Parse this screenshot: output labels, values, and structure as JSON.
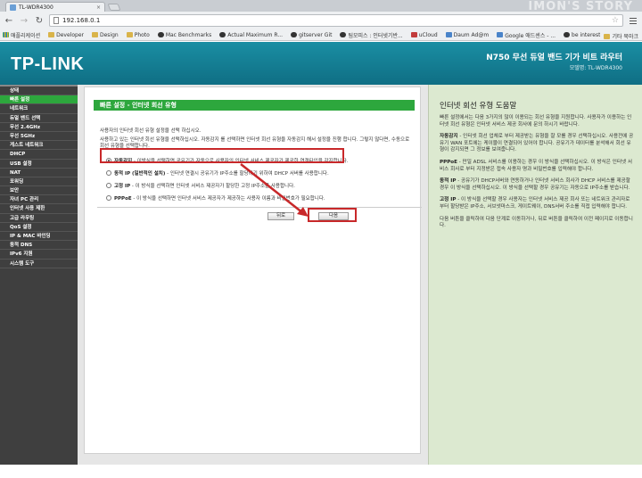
{
  "browser": {
    "tab_title": "TL-WDR4300",
    "tab_close": "×",
    "url": "192.168.0.1",
    "watermark": "IMON'S STORY",
    "bookmarks": [
      {
        "label": "애플리케이션",
        "icon": "apps-grid-icon"
      },
      {
        "label": "Developer",
        "icon": "folder-icon"
      },
      {
        "label": "Design",
        "icon": "folder-icon"
      },
      {
        "label": "Photo",
        "icon": "folder-icon"
      },
      {
        "label": "Mac Benchmarks",
        "icon": "apple-icon"
      },
      {
        "label": "Actual Maximum R...",
        "icon": "site-icon"
      },
      {
        "label": "gitserver Git",
        "icon": "git-icon"
      },
      {
        "label": "팀모피스 : 인터넷기반...",
        "icon": "site-icon"
      },
      {
        "label": "uCloud",
        "icon": "cloud-icon"
      },
      {
        "label": "Daum Ad@m",
        "icon": "daum-icon"
      },
      {
        "label": "Google 애드센스 - ...",
        "icon": "google-icon"
      },
      {
        "label": "be interested in...",
        "icon": "site-icon"
      }
    ],
    "other_bookmarks": "기타 북마크"
  },
  "header": {
    "logo": "TP-LINK",
    "product": "N750 무선 듀얼 밴드 기가 비트 라우터",
    "model": "모델명: TL-WDR4300"
  },
  "nav": {
    "items": [
      {
        "label": "상태",
        "active": false
      },
      {
        "label": "빠른 설정",
        "active": true
      },
      {
        "label": "네트워크",
        "active": false
      },
      {
        "label": "듀얼 밴드 선택",
        "active": false
      },
      {
        "label": "무선 2.4GHz",
        "active": false
      },
      {
        "label": "무선 5GHz",
        "active": false
      },
      {
        "label": "게스트 네트워크",
        "active": false
      },
      {
        "label": "DHCP",
        "active": false
      },
      {
        "label": "USB 설정",
        "active": false
      },
      {
        "label": "NAT",
        "active": false
      },
      {
        "label": "포워딩",
        "active": false
      },
      {
        "label": "보안",
        "active": false
      },
      {
        "label": "자녀 PC 관리",
        "active": false
      },
      {
        "label": "인터넷 사용 제한",
        "active": false
      },
      {
        "label": "고급 라우팅",
        "active": false
      },
      {
        "label": "QoS 설정",
        "active": false
      },
      {
        "label": "IP & MAC 바인딩",
        "active": false
      },
      {
        "label": "동적 DNS",
        "active": false
      },
      {
        "label": "IPv6 지원",
        "active": false
      },
      {
        "label": "시스템 도구",
        "active": false
      }
    ]
  },
  "main": {
    "title": "빠른 설정 - 인터넷 회선 유형",
    "desc1": "사용자의 인터넷 회선 유형 설정을 선택 하십시오.",
    "desc2": "사용하고 있는 인터넷 회선 유형을 선택하십시오. 자동감지 를 선택하면 인터넷 회선 유형을 자동감지 해서 설정을 진행 합니다. 그렇지 않다면, 수동으로 회선 유형을 선택합니다.",
    "options": [
      {
        "name": "자동감지",
        "text": " - 이방식을 선택하면 공유기가 자동으로 사용자의 인터넷 서비스 제공자가 제공한 연결타입을 감지합니다.",
        "selected": true
      },
      {
        "name": "동적 IP (일반적인 설치)",
        "text": " - 인터넷 연결시 공유기가 IP주소를 할당하기 위하여 DHCP 서버를 사용합니다.",
        "selected": false
      },
      {
        "name": "고정 IP",
        "text": " - 이 방식을 선택하면 인터넷 서비스 제공자가 할당한 고정 IP주소를 사용합니다.",
        "selected": false
      },
      {
        "name": "PPPoE",
        "text": " - 이 방식을 선택하면 인터넷 서비스 제공자가 제공하는 사용자 이름과 비밀번호가 필요합니다.",
        "selected": false
      }
    ],
    "back_label": "뒤로",
    "next_label": "다음"
  },
  "help": {
    "title": "인터넷 회선 유형 도움말",
    "intro": "빠른 설정에서는 다음 3가지의 많이 이용되는 회선 유형을 지원합니다. 사용자가 이용하는 인터넷 회선 유형은 인터넷 서비스 제공 회사에 문의 하시기 바랍니다.",
    "auto_name": "자동감지",
    "auto_text": " - 인터넷 회선 업체로 부터 제공받는 유형을 잘 모를 경우 선택하십시오. 사용전에 공유기 WAN 포트에는 케이블이 연결되어 있어야 합니다. 공유기가 데이터를 분석해서 회선 유형이 감지되면 그 정보를 보여줍니다.",
    "pppoe_name": "PPPoE",
    "pppoe_text": " - 만일 ADSL 서비스를 이용하는 경우 이 방식을 선택하십시오. 이 방식은 인터넷 서비스 회사로 부터 지정받은 접속 사용자 명과 비밀번호를 입력해야 합니다.",
    "dyn_name": "동적 IP",
    "dyn_text": " - 공유기가 DHCP서버와 연동하거나 인터넷 서비스 회사가 DHCP 서비스를 제공할 경우 이 방식을 선택하십시오. 이 방식을 선택할 경우 공유기는 자동으로 IP주소를 받습니다.",
    "static_name": "고정 IP",
    "static_text": " - 이 방식을 선택할 경우 사용자는 인터넷 서비스 제공 회사 또는 네트워크 관리자로 부터 할당받은 IP주소, 서브넷마스크, 게이트웨이, DNS서버 주소를 직접 입력해야 합니다.",
    "outro": "다음 버튼을 클릭하여 다음 단계로 이동하거나, 뒤로 버튼을 클릭하여 이전 페이지로 이동합니다."
  }
}
